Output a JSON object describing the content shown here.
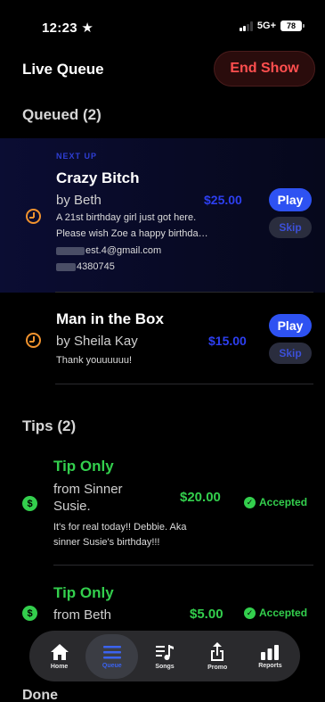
{
  "status_bar": {
    "time": "12:23",
    "network": "5G+",
    "battery": "78"
  },
  "header": {
    "title": "Live Queue",
    "end_show_label": "End Show"
  },
  "queued": {
    "title": "Queued (2)",
    "items": [
      {
        "badge": "NEXT UP",
        "song": "Crazy Bitch",
        "requester": "by Beth",
        "amount": "$25.00",
        "message_line1": "A 21st birthday girl just got here.",
        "message_line2": "Please wish Zoe a happy birthda…",
        "email_suffix": "est.4@gmail.com",
        "phone_suffix": "4380745",
        "play_label": "Play",
        "skip_label": "Skip"
      },
      {
        "song": "Man in the Box",
        "requester": "by Sheila Kay",
        "amount": "$15.00",
        "message": "Thank youuuuuu!",
        "play_label": "Play",
        "skip_label": "Skip"
      }
    ]
  },
  "tips": {
    "title": "Tips (2)",
    "items": [
      {
        "title": "Tip Only",
        "from_line1": "from Sinner",
        "from_line2": "Susie.",
        "amount": "$20.00",
        "status": "Accepted",
        "message_line1": "It's for real today!! Debbie. Aka",
        "message_line2": "sinner Susie's birthday!!!"
      },
      {
        "title": "Tip Only",
        "from_line1": "from Beth",
        "amount": "$5.00",
        "status": "Accepted"
      }
    ]
  },
  "done": {
    "title": "Done"
  },
  "tab_bar": {
    "tabs": [
      {
        "label": "Home",
        "icon": "house-icon",
        "active": false
      },
      {
        "label": "Queue",
        "icon": "list-icon",
        "active": true
      },
      {
        "label": "Songs",
        "icon": "music-list-icon",
        "active": false
      },
      {
        "label": "Promo",
        "icon": "share-icon",
        "active": false
      },
      {
        "label": "Reports",
        "icon": "bar-chart-icon",
        "active": false
      }
    ]
  },
  "colors": {
    "accent_blue": "#2e52f2",
    "tip_green": "#33cf4d",
    "end_show_red": "#ff4f4f",
    "clock_orange": "#f0922e"
  }
}
